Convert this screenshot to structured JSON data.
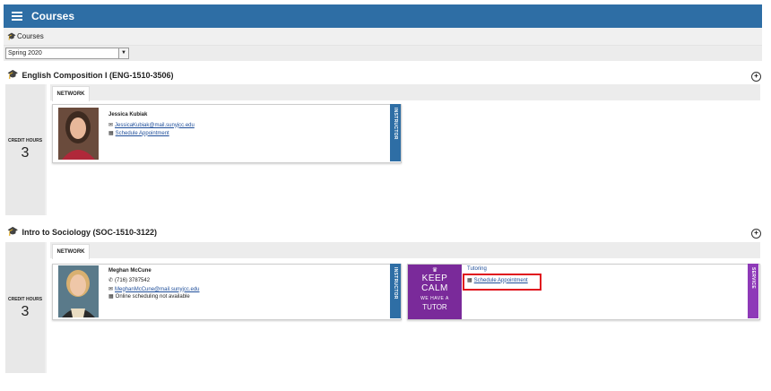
{
  "header": {
    "title": "Courses",
    "menu_icon": "hamburger-icon"
  },
  "breadcrumb": {
    "icon": "graduation-cap-icon",
    "label": "Courses"
  },
  "term_select": {
    "value": "Spring 2020",
    "arrow_icon": "chevron-down-icon"
  },
  "colors": {
    "header_bg": "#2e6ea5",
    "instructor_tab": "#2e6ea5",
    "service_tab": "#8e3ab8",
    "poster_bg": "#7a2a9a",
    "highlight": "#e0141e",
    "link": "#1f4e9a"
  },
  "courses": [
    {
      "title": "English Composition I (ENG-1510-3506)",
      "credit_label": "CREDIT HOURS",
      "credit_value": "3",
      "tab": "NETWORK",
      "instructor": {
        "name": "Jessica Kubiak",
        "email": "JessicaKubiak@mail.sunyjcc.edu",
        "schedule": "Schedule Appointment",
        "role_tab": "INSTRUCTOR"
      }
    },
    {
      "title": "Intro to Sociology (SOC-1510-3122)",
      "credit_label": "CREDIT HOURS",
      "credit_value": "3",
      "tab": "NETWORK",
      "instructor": {
        "name": "Meghan McCune",
        "phone": "(716) 3787542",
        "email": "MeghanMcCune@mail.sunyjcc.edu",
        "scheduling_note": "Online scheduling not available",
        "role_tab": "INSTRUCTOR"
      },
      "service": {
        "name": "Tutoring",
        "schedule": "Schedule Appointment",
        "role_tab": "SERVICE",
        "poster_lines": [
          "KEEP",
          "CALM",
          "WE HAVE A",
          "TUTOR"
        ]
      }
    }
  ]
}
